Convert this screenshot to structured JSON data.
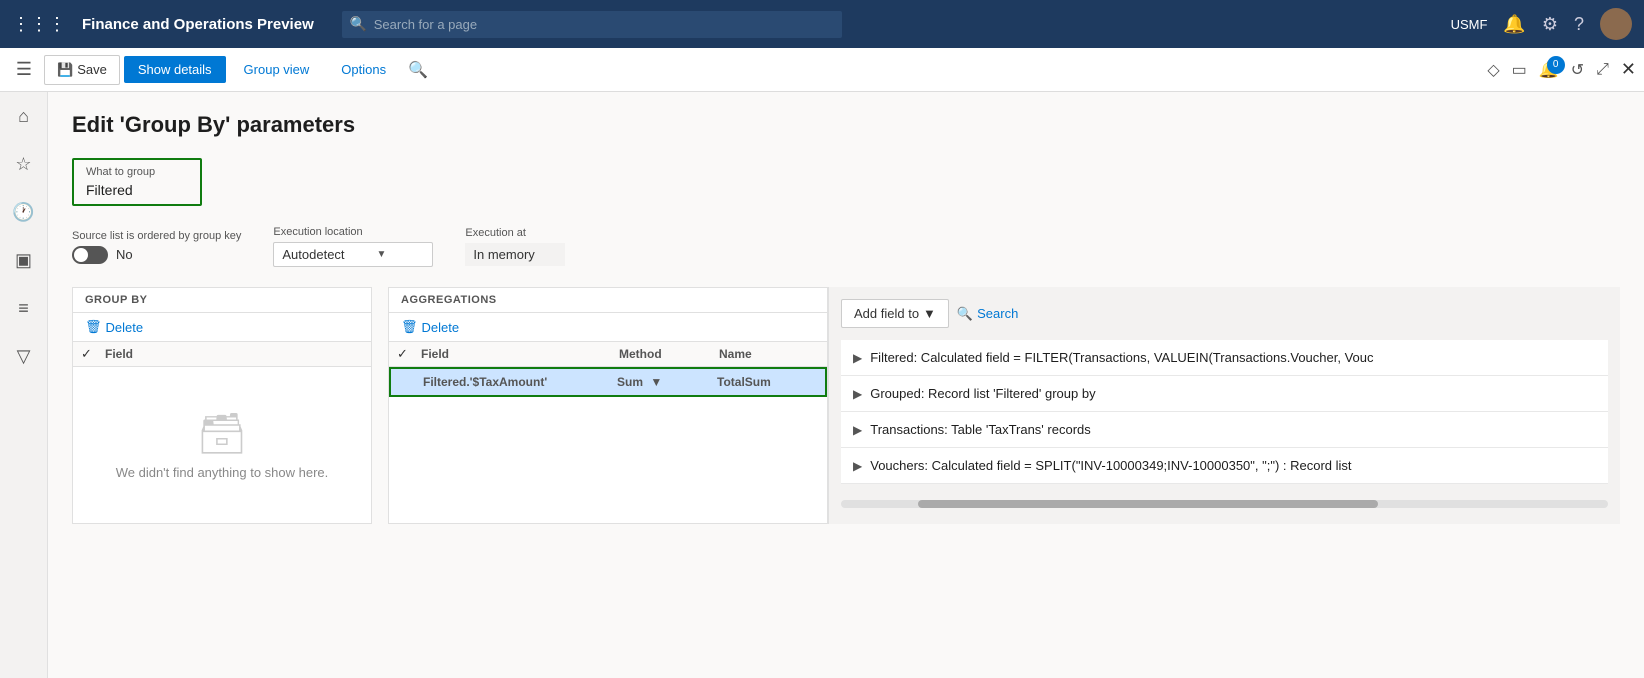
{
  "topnav": {
    "app_title": "Finance and Operations Preview",
    "search_placeholder": "Search for a page",
    "company": "USMF"
  },
  "toolbar": {
    "save_label": "Save",
    "show_details_label": "Show details",
    "group_view_label": "Group view",
    "options_label": "Options",
    "notification_count": "0"
  },
  "page": {
    "title": "Edit 'Group By' parameters"
  },
  "what_to_group": {
    "label": "What to group",
    "value": "Filtered"
  },
  "settings": {
    "source_list_label": "Source list is ordered by group key",
    "toggle_value": "No",
    "execution_location_label": "Execution location",
    "execution_location_value": "Autodetect",
    "execution_at_label": "Execution at",
    "execution_at_value": "In memory"
  },
  "group_by": {
    "section_label": "GROUP BY",
    "delete_label": "Delete",
    "col_field": "Field",
    "empty_text": "We didn't find anything to show here."
  },
  "aggregations": {
    "section_label": "AGGREGATIONS",
    "delete_label": "Delete",
    "col_field": "Field",
    "col_method": "Method",
    "col_name": "Name",
    "row": {
      "field": "Filtered.'$TaxAmount'",
      "method": "Sum",
      "name": "TotalSum"
    }
  },
  "right_panel": {
    "add_field_label": "Add field to",
    "search_label": "Search",
    "fields": [
      {
        "text": "Filtered: Calculated field = FILTER(Transactions, VALUEIN(Transactions.Voucher, Vouc"
      },
      {
        "text": "Grouped: Record list 'Filtered' group by"
      },
      {
        "text": "Transactions: Table 'TaxTrans' records"
      },
      {
        "text": "Vouchers: Calculated field = SPLIT(\"INV-10000349;INV-10000350\", \";\") : Record list"
      }
    ]
  }
}
